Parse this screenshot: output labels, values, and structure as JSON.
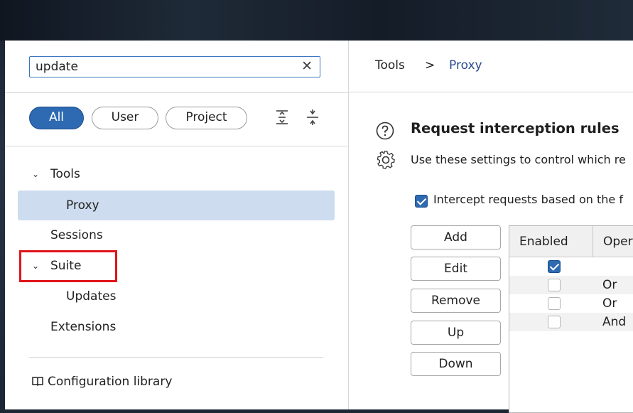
{
  "search": {
    "value": "update",
    "clear_icon": "close-icon"
  },
  "filters": {
    "all": "All",
    "user": "User",
    "project": "Project",
    "expand_icon": "expand-all-icon",
    "collapse_icon": "collapse-all-icon"
  },
  "tree": {
    "tools": "Tools",
    "proxy": "Proxy",
    "sessions": "Sessions",
    "suite": "Suite",
    "updates": "Updates",
    "extensions": "Extensions"
  },
  "config_library": {
    "label": "Configuration library",
    "icon": "book-icon"
  },
  "breadcrumb": {
    "root": "Tools",
    "separator": ">",
    "current": "Proxy"
  },
  "section": {
    "title": "Request interception rules",
    "description": "Use these settings to control which re",
    "intercept_label": "Intercept requests based on the f"
  },
  "buttons": {
    "add": "Add",
    "edit": "Edit",
    "remove": "Remove",
    "up": "Up",
    "down": "Down"
  },
  "table": {
    "headers": [
      "Enabled",
      "Oper"
    ],
    "rows": [
      {
        "enabled": true,
        "operator": ""
      },
      {
        "enabled": false,
        "operator": "Or"
      },
      {
        "enabled": false,
        "operator": "Or"
      },
      {
        "enabled": false,
        "operator": "And"
      }
    ]
  },
  "colors": {
    "accent": "#2e6ab1",
    "selection": "#cddcef",
    "highlight_box": "#e0141a",
    "link": "#2b4a8b"
  }
}
